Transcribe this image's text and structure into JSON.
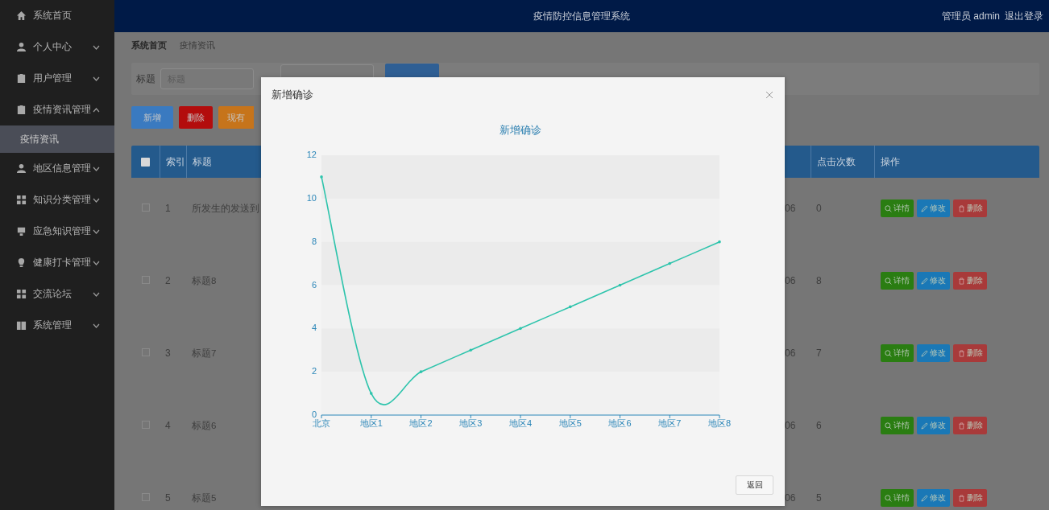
{
  "header": {
    "title": "疫情防控信息管理系统",
    "user": "管理员 admin",
    "logout": "退出登录"
  },
  "sidebar": {
    "items": [
      {
        "label": "系统首页",
        "kind": "link"
      },
      {
        "label": "个人中心",
        "kind": "group",
        "expanded": false
      },
      {
        "label": "用户管理",
        "kind": "group",
        "expanded": false
      },
      {
        "label": "疫情资讯管理",
        "kind": "group",
        "expanded": true,
        "children": [
          {
            "label": "疫情资讯",
            "selected": true
          }
        ]
      },
      {
        "label": "地区信息管理",
        "kind": "group",
        "expanded": false
      },
      {
        "label": "知识分类管理",
        "kind": "group",
        "expanded": false
      },
      {
        "label": "应急知识管理",
        "kind": "group",
        "expanded": false
      },
      {
        "label": "健康打卡管理",
        "kind": "group",
        "expanded": false
      },
      {
        "label": "交流论坛",
        "kind": "group",
        "expanded": false
      },
      {
        "label": "系统管理",
        "kind": "group",
        "expanded": false
      }
    ]
  },
  "breadcrumb": [
    "系统首页",
    "疫情资讯"
  ],
  "search": {
    "label": "标题",
    "placeholder": "标题"
  },
  "toolbar": [
    {
      "label": "新增",
      "kind": "add"
    },
    {
      "label": "删除",
      "kind": "delete"
    },
    {
      "label": "现有",
      "kind": "other"
    }
  ],
  "table": {
    "select_all_checked": false,
    "columns": [
      {
        "label": "索引",
        "kind": "index"
      },
      {
        "label": "标题",
        "kind": "title"
      },
      {
        "label": "点击次数",
        "kind": "clicks"
      },
      {
        "label": "操作",
        "kind": "actions"
      }
    ],
    "rows": [
      {
        "checked": false,
        "index": "1",
        "title": "所发生的发送到",
        "column_5": "06",
        "clicks": "0",
        "actions": [
          {
            "label": "详情",
            "kind": "detail"
          },
          {
            "label": "修改",
            "kind": "edit"
          },
          {
            "label": "删除",
            "kind": "delete"
          }
        ]
      },
      {
        "checked": false,
        "index": "2",
        "title": "标题8",
        "column_5": "06",
        "clicks": "8",
        "actions": [
          {
            "label": "详情",
            "kind": "detail"
          },
          {
            "label": "修改",
            "kind": "edit"
          },
          {
            "label": "删除",
            "kind": "delete"
          }
        ]
      },
      {
        "checked": false,
        "index": "3",
        "title": "标题7",
        "column_5": "06",
        "clicks": "7",
        "actions": [
          {
            "label": "详情",
            "kind": "detail"
          },
          {
            "label": "修改",
            "kind": "edit"
          },
          {
            "label": "删除",
            "kind": "delete"
          }
        ]
      },
      {
        "checked": false,
        "index": "4",
        "title": "标题6",
        "column_5": "06",
        "clicks": "6",
        "actions": [
          {
            "label": "详情",
            "kind": "detail"
          },
          {
            "label": "修改",
            "kind": "edit"
          },
          {
            "label": "删除",
            "kind": "delete"
          }
        ]
      },
      {
        "checked": false,
        "index": "5",
        "title": "标题5",
        "column_5": "06",
        "clicks": "5",
        "actions": [
          {
            "label": "详情",
            "kind": "detail"
          },
          {
            "label": "修改",
            "kind": "edit"
          },
          {
            "label": "删除",
            "kind": "delete"
          }
        ]
      }
    ]
  },
  "modal": {
    "title": "新增确诊",
    "button": "返回",
    "chart_data": {
      "type": "line",
      "title": "新增确诊",
      "categories": [
        "北京",
        "地区1",
        "地区2",
        "地区3",
        "地区4",
        "地区5",
        "地区6",
        "地区7",
        "地区8"
      ],
      "series": [
        {
          "color": "#2ec4ac",
          "values": [
            11,
            1,
            2,
            3,
            4,
            5,
            6,
            7,
            8
          ]
        }
      ],
      "ylim": [
        0,
        12
      ],
      "yticks": [
        0,
        2,
        4,
        6,
        8,
        10,
        12
      ]
    }
  }
}
